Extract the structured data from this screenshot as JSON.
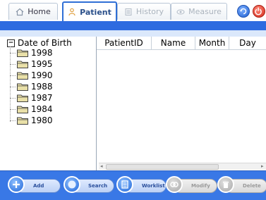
{
  "tabs": [
    {
      "label": "Home",
      "icon": "home-icon",
      "state": "normal"
    },
    {
      "label": "Patient",
      "icon": "patient-icon",
      "state": "active"
    },
    {
      "label": "History",
      "icon": "history-icon",
      "state": "disabled"
    },
    {
      "label": "Measure",
      "icon": "measure-icon",
      "state": "disabled"
    }
  ],
  "top_buttons": [
    {
      "icon": "refresh-icon"
    },
    {
      "icon": "power-icon"
    }
  ],
  "tree": {
    "root_label": "Date of Birth",
    "items": [
      "1998",
      "1995",
      "1990",
      "1988",
      "1987",
      "1984",
      "1980"
    ]
  },
  "table": {
    "columns": [
      "PatientID",
      "Name",
      "Month",
      "Day"
    ],
    "rows": []
  },
  "toolbar": {
    "add_label": "Add",
    "search_label": "Search",
    "worklist_label": "Worklist",
    "modify_label": "Modify",
    "delete_label": "Delete"
  },
  "colors": {
    "accent": "#2e6be0",
    "toolbar_bg": "#3978e6"
  }
}
